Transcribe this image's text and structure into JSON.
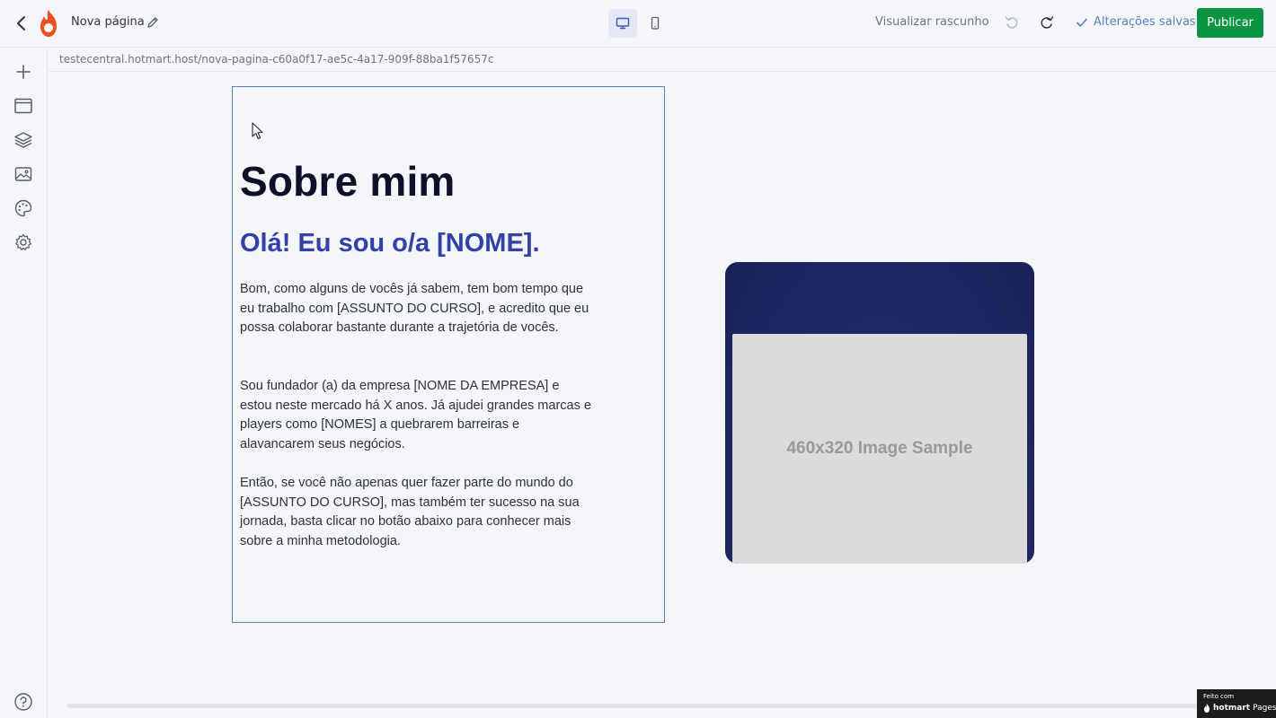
{
  "header": {
    "page_name": "Nova página",
    "preview_draft": "Visualizar rascunho",
    "saved_status": "Alterações salvas",
    "publish_label": "Publicar"
  },
  "url": "testecentral.hotmart.host/nova-pagina-c60a0f17-ae5c-4a17-909f-88ba1f57657c",
  "content": {
    "heading": "Sobre mim",
    "subheading": "Olá! Eu sou o/a [NOME].",
    "paragraphs": [
      "Bom, como alguns de vocês já sabem, tem bom tempo que eu trabalho com [ASSUNTO DO CURSO], e acredito que eu possa colaborar bastante durante a trajetória de vocês.",
      "Sou fundador (a) da empresa [NOME DA EMPRESA] e estou neste mercado há X anos. Já ajudei grandes marcas e players como [NOMES] a quebrarem barreiras e alavancarem seus negócios.",
      "Então, se você não apenas quer fazer parte do mundo do [ASSUNTO DO CURSO], mas também ter sucesso na sua jornada, basta clicar no botão abaixo para conhecer mais sobre a minha metodologia."
    ],
    "image_label": "460x320 Image Sample"
  },
  "badge": {
    "small": "Feito com",
    "brand": "hotmart",
    "suffix": "Pages"
  },
  "colors": {
    "publish": "#0b9444",
    "accent": "#3141a8",
    "saved": "#5a7fc4",
    "image_frame": "#1b215a"
  },
  "icons": {
    "sidebar": [
      "plus-icon",
      "window-icon",
      "layers-icon",
      "image-gallery-icon",
      "palette-icon",
      "gear-icon"
    ],
    "help": "help-icon"
  }
}
